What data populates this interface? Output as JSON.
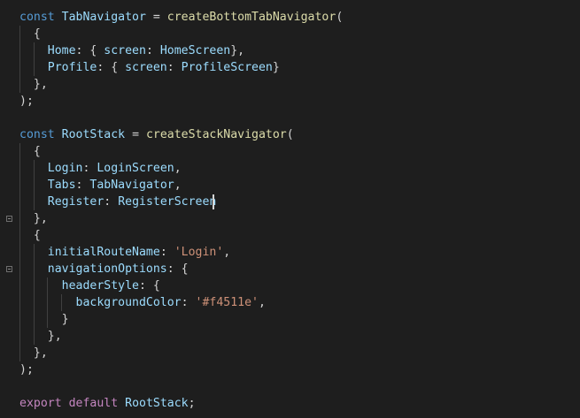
{
  "editor": {
    "lines": [
      {
        "tokens": [
          {
            "t": "kw",
            "v": "const"
          },
          {
            "t": "pun",
            "v": " "
          },
          {
            "t": "var",
            "v": "TabNavigator"
          },
          {
            "t": "pun",
            "v": " = "
          },
          {
            "t": "fn",
            "v": "createBottomTabNavigator"
          },
          {
            "t": "pun",
            "v": "("
          }
        ]
      },
      {
        "tokens": [
          {
            "t": "pun",
            "v": "  {"
          }
        ]
      },
      {
        "tokens": [
          {
            "t": "pun",
            "v": "    "
          },
          {
            "t": "var",
            "v": "Home"
          },
          {
            "t": "pun",
            "v": ": { "
          },
          {
            "t": "var",
            "v": "screen"
          },
          {
            "t": "pun",
            "v": ": "
          },
          {
            "t": "var",
            "v": "HomeScreen"
          },
          {
            "t": "pun",
            "v": "},"
          }
        ]
      },
      {
        "tokens": [
          {
            "t": "pun",
            "v": "    "
          },
          {
            "t": "var",
            "v": "Profile"
          },
          {
            "t": "pun",
            "v": ": { "
          },
          {
            "t": "var",
            "v": "screen"
          },
          {
            "t": "pun",
            "v": ": "
          },
          {
            "t": "var",
            "v": "ProfileScreen"
          },
          {
            "t": "pun",
            "v": "}"
          }
        ]
      },
      {
        "tokens": [
          {
            "t": "pun",
            "v": "  },"
          }
        ]
      },
      {
        "tokens": [
          {
            "t": "pun",
            "v": ");"
          }
        ]
      },
      {
        "tokens": []
      },
      {
        "tokens": [
          {
            "t": "kw",
            "v": "const"
          },
          {
            "t": "pun",
            "v": " "
          },
          {
            "t": "var",
            "v": "RootStack"
          },
          {
            "t": "pun",
            "v": " = "
          },
          {
            "t": "fn",
            "v": "createStackNavigator"
          },
          {
            "t": "pun",
            "v": "("
          }
        ]
      },
      {
        "tokens": [
          {
            "t": "pun",
            "v": "  {"
          }
        ]
      },
      {
        "tokens": [
          {
            "t": "pun",
            "v": "    "
          },
          {
            "t": "var",
            "v": "Login"
          },
          {
            "t": "pun",
            "v": ": "
          },
          {
            "t": "var",
            "v": "LoginScreen"
          },
          {
            "t": "pun",
            "v": ","
          }
        ]
      },
      {
        "tokens": [
          {
            "t": "pun",
            "v": "    "
          },
          {
            "t": "var",
            "v": "Tabs"
          },
          {
            "t": "pun",
            "v": ": "
          },
          {
            "t": "var",
            "v": "TabNavigator"
          },
          {
            "t": "pun",
            "v": ","
          }
        ]
      },
      {
        "tokens": [
          {
            "t": "pun",
            "v": "    "
          },
          {
            "t": "var",
            "v": "Register"
          },
          {
            "t": "pun",
            "v": ": "
          },
          {
            "t": "var",
            "v": "RegisterScreen"
          }
        ]
      },
      {
        "tokens": [
          {
            "t": "pun",
            "v": "  },"
          }
        ]
      },
      {
        "tokens": [
          {
            "t": "pun",
            "v": "  {"
          }
        ]
      },
      {
        "tokens": [
          {
            "t": "pun",
            "v": "    "
          },
          {
            "t": "var",
            "v": "initialRouteName"
          },
          {
            "t": "pun",
            "v": ": "
          },
          {
            "t": "str",
            "v": "'Login'"
          },
          {
            "t": "pun",
            "v": ","
          }
        ]
      },
      {
        "tokens": [
          {
            "t": "pun",
            "v": "    "
          },
          {
            "t": "var",
            "v": "navigationOptions"
          },
          {
            "t": "pun",
            "v": ": {"
          }
        ]
      },
      {
        "tokens": [
          {
            "t": "pun",
            "v": "      "
          },
          {
            "t": "var",
            "v": "headerStyle"
          },
          {
            "t": "pun",
            "v": ": {"
          }
        ]
      },
      {
        "tokens": [
          {
            "t": "pun",
            "v": "        "
          },
          {
            "t": "var",
            "v": "backgroundColor"
          },
          {
            "t": "pun",
            "v": ": "
          },
          {
            "t": "str",
            "v": "'#f4511e'"
          },
          {
            "t": "pun",
            "v": ","
          }
        ]
      },
      {
        "tokens": [
          {
            "t": "pun",
            "v": "      }"
          }
        ]
      },
      {
        "tokens": [
          {
            "t": "pun",
            "v": "    },"
          }
        ]
      },
      {
        "tokens": [
          {
            "t": "pun",
            "v": "  },"
          }
        ]
      },
      {
        "tokens": [
          {
            "t": "pun",
            "v": ");"
          }
        ]
      },
      {
        "tokens": []
      },
      {
        "tokens": [
          {
            "t": "kwc",
            "v": "export"
          },
          {
            "t": "pun",
            "v": " "
          },
          {
            "t": "kwc",
            "v": "default"
          },
          {
            "t": "pun",
            "v": " "
          },
          {
            "t": "var",
            "v": "RootStack"
          },
          {
            "t": "pun",
            "v": ";"
          }
        ]
      }
    ]
  },
  "colors": {
    "background": "#1e1e1e",
    "keyword": "#569cd6",
    "variable": "#9cdcfe",
    "function": "#dcdcaa",
    "string": "#ce9178",
    "punctuation": "#d4d4d4",
    "control": "#c586c0",
    "indent_guide": "#404040"
  },
  "icons": {
    "fold_marker": "fold-minus-icon",
    "text_cursor": "text-cursor-icon"
  }
}
